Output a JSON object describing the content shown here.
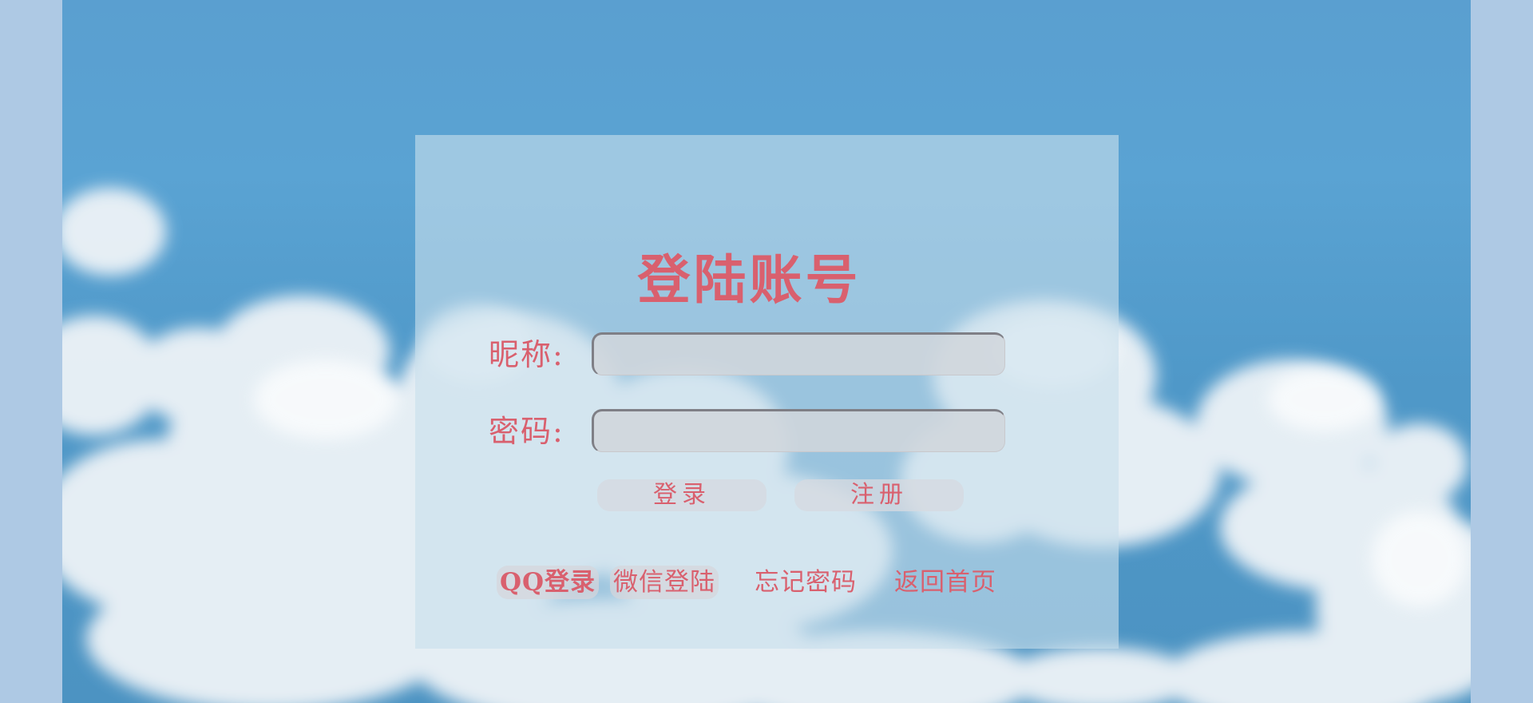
{
  "login": {
    "title": "登陆账号",
    "nickname_label": "昵称:",
    "nickname_value": "",
    "password_label": "密码:",
    "password_value": "",
    "login_button": "登录",
    "register_button": "注册"
  },
  "links": {
    "qq_login": "QQ登录",
    "wechat_login": "微信登陆",
    "forgot_password": "忘记密码",
    "back_home": "返回首页"
  },
  "colors": {
    "accent_text": "#d9606e",
    "sky": "#5aa3d3",
    "page_bg": "#aec9e4"
  }
}
